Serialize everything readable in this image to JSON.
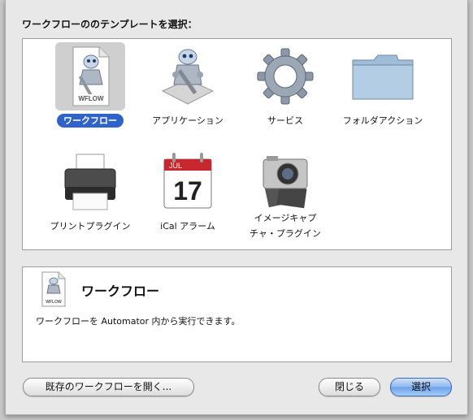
{
  "dialog": {
    "prompt": "ワークフローののテンプレートを選択："
  },
  "templates": [
    {
      "label": "ワークフロー",
      "icon": "workflow-document-icon",
      "badge": "WFLOW",
      "selected": true
    },
    {
      "label": "アプリケーション",
      "icon": "automator-robot-icon",
      "selected": false
    },
    {
      "label": "サービス",
      "icon": "gear-icon",
      "selected": false
    },
    {
      "label": "フォルダアクション",
      "icon": "folder-icon",
      "selected": false
    },
    {
      "label": "プリントプラグイン",
      "icon": "printer-icon",
      "selected": false
    },
    {
      "label": "iCal アラーム",
      "icon": "ical-calendar-icon",
      "calendar_month": "JUL",
      "calendar_day": "17",
      "selected": false
    },
    {
      "label_line1": "イメージキャプ",
      "label_line2": "チャ・プラグイン",
      "icon": "camera-icon",
      "selected": false
    }
  ],
  "description": {
    "icon": "workflow-document-icon",
    "badge": "WFLOW",
    "title": "ワークフロー",
    "text": "ワークフローを Automator 内から実行できます。"
  },
  "buttons": {
    "open_existing": "既存のワークフローを開く...",
    "close": "閉じる",
    "choose": "選択"
  },
  "colors": {
    "selection": "#2f63c9",
    "primary_button": "#6aa2ec"
  }
}
